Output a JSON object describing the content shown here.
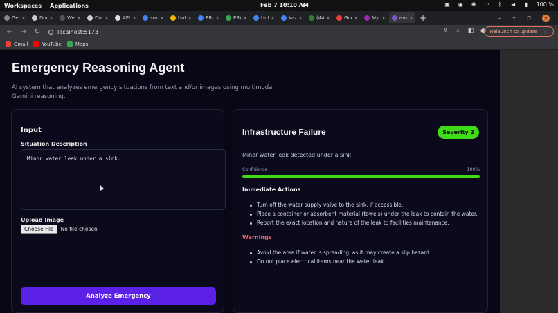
{
  "os": {
    "workspaces": "Workspaces",
    "applications": "Applications",
    "clock": "Feb 7  10:10 AM",
    "battery": "100 %"
  },
  "browser": {
    "tabs": [
      {
        "title": "Gen",
        "color": "#888"
      },
      {
        "title": "Dor",
        "color": "#ccc"
      },
      {
        "title": "Wel",
        "color": "#555"
      },
      {
        "title": "Dor",
        "color": "#ccc"
      },
      {
        "title": "API",
        "color": "#e0e0e0"
      },
      {
        "title": "sma",
        "color": "#4285f4"
      },
      {
        "title": "Unt",
        "color": "#f4b400"
      },
      {
        "title": "ERA",
        "color": "#4285f4"
      },
      {
        "title": "ERA",
        "color": "#34a853"
      },
      {
        "title": "Unt",
        "color": "#4285f4"
      },
      {
        "title": "kaz",
        "color": "#4285f4"
      },
      {
        "title": "(44",
        "color": "#2e7d32"
      },
      {
        "title": "Goc",
        "color": "#ea4335"
      },
      {
        "title": "My",
        "color": "#9c27b0"
      },
      {
        "title": "em",
        "color": "#7e57c2"
      }
    ],
    "new_tab": "+",
    "url": "localhost:5173",
    "relaunch": "Relaunch to update",
    "bookmarks": [
      {
        "label": "Gmail",
        "color": "#ea4335"
      },
      {
        "label": "YouTube",
        "color": "#ff0000"
      },
      {
        "label": "Maps",
        "color": "#34a853"
      }
    ]
  },
  "page": {
    "title": "Emergency Reasoning Agent",
    "description": "AI system that analyzes emergency situations from text and/or images using multimodal Gemini reasoning."
  },
  "input_card": {
    "heading": "Input",
    "situation_label": "Situation Description",
    "situation_value": "Minor water leak under a sink.",
    "upload_label": "Upload Image",
    "choose_file": "Choose File",
    "no_file": "No file chosen",
    "analyze_button": "Analyze Emergency"
  },
  "result_card": {
    "title": "Infrastructure Failure",
    "severity": "Severity 2",
    "severity_color": "#3ddc17",
    "summary": "Minor water leak detected under a sink.",
    "confidence_label": "Confidence",
    "confidence_text": "100%",
    "confidence_value": 1.0,
    "actions_heading": "Immediate Actions",
    "actions": [
      "Turn off the water supply valve to the sink, if accessible.",
      "Place a container or absorbent material (towels) under the leak to contain the water.",
      "Report the exact location and nature of the leak to facilities maintenance."
    ],
    "warnings_heading": "Warnings",
    "warnings_color": "#f26a6a",
    "warnings": [
      "Avoid the area if water is spreading, as it may create a slip hazard.",
      "Do not place electrical items near the water leak."
    ]
  }
}
